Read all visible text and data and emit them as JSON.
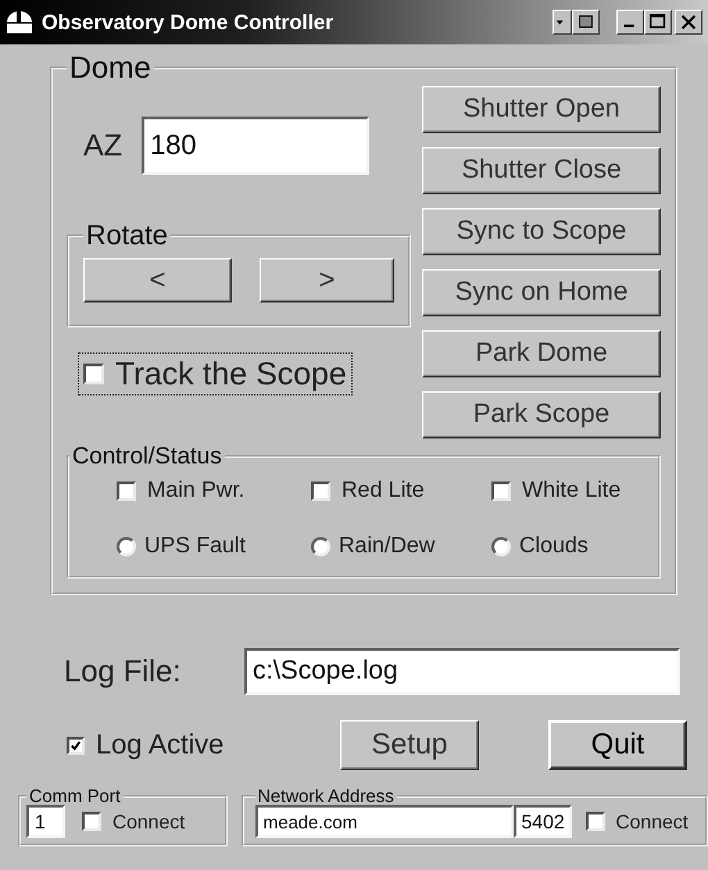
{
  "window": {
    "title": "Observatory Dome Controller"
  },
  "dome": {
    "title": "Dome",
    "az": {
      "label": "AZ",
      "value": "180"
    },
    "rotate": {
      "title": "Rotate",
      "buttons": [
        "<",
        ">"
      ]
    },
    "track": {
      "label": "Track the Scope",
      "checked": false,
      "focused": true
    },
    "buttons": [
      "Shutter Open",
      "Shutter Close",
      "Sync to Scope",
      "Sync on Home",
      "Park Dome",
      "Park Scope"
    ],
    "control_status": {
      "title": "Control/Status",
      "items": [
        {
          "kind": "checkbox",
          "label": "Main Pwr.",
          "checked": false
        },
        {
          "kind": "checkbox",
          "label": "Red Lite",
          "checked": false
        },
        {
          "kind": "checkbox",
          "label": "White Lite",
          "checked": false
        },
        {
          "kind": "radio",
          "label": "UPS Fault",
          "selected": false
        },
        {
          "kind": "radio",
          "label": "Rain/Dew",
          "selected": false
        },
        {
          "kind": "radio",
          "label": "Clouds",
          "selected": false
        }
      ]
    }
  },
  "log": {
    "label": "Log File:",
    "value": "c:\\Scope.log",
    "active": {
      "label": "Log Active",
      "checked": true
    }
  },
  "buttons": [
    {
      "label": "Setup",
      "default": false
    },
    {
      "label": "Quit",
      "default": true
    }
  ],
  "comm_port": {
    "title": "Comm Port",
    "value": "1",
    "connect": {
      "label": "Connect",
      "checked": false
    }
  },
  "network": {
    "title": "Network Address",
    "host": "meade.com",
    "port": "5402",
    "connect": {
      "label": "Connect",
      "checked": false
    }
  }
}
